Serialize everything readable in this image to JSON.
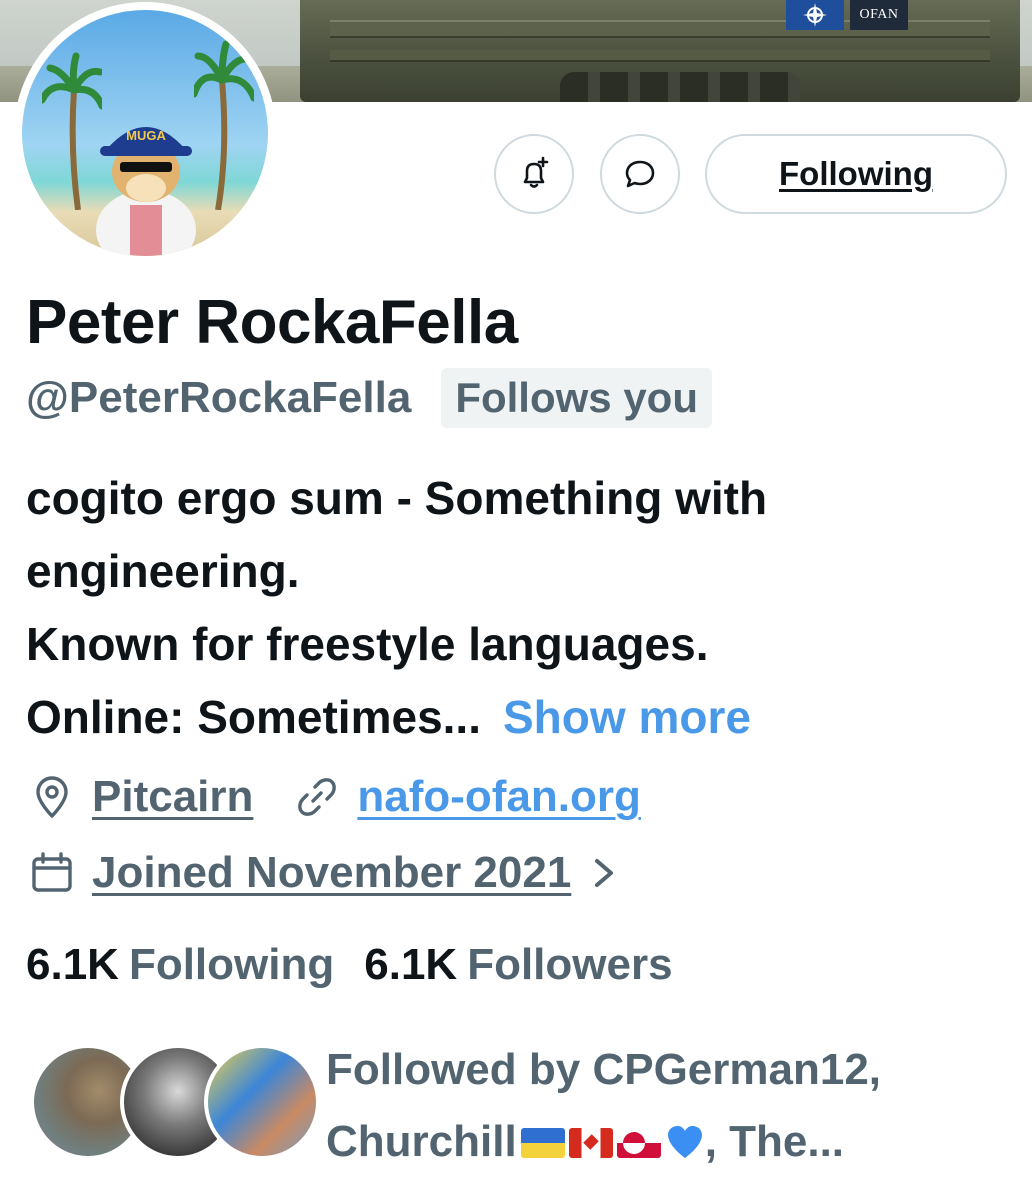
{
  "banner": {
    "nato_flag_icon": "nato-compass-icon",
    "ofan_label": "OFAN"
  },
  "avatar": {
    "cap_text": "MUGA"
  },
  "actions": {
    "following_label": "Following"
  },
  "profile": {
    "name": "Peter RockaFella",
    "handle": "@PeterRockaFella",
    "follows_you": "Follows you",
    "bio_lines": [
      "cogito ergo sum - Something with",
      "engineering.",
      "Known for freestyle languages.",
      "Online: Sometimes..."
    ],
    "show_more": "Show more",
    "location": "Pitcairn",
    "website": "nafo-ofan.org",
    "joined": "Joined November 2021"
  },
  "stats": {
    "following_count": "6.1K",
    "following_label": "Following",
    "followers_count": "6.1K",
    "followers_label": "Followers"
  },
  "followed_by": {
    "line1": "Followed by CPGerman12,",
    "line2_prefix": "Churchill",
    "line2_suffix": ", The..."
  },
  "colors": {
    "link": "#4a99e9",
    "secondary_text": "#536471",
    "primary_text": "#0f1419",
    "border": "#cfd9de"
  }
}
